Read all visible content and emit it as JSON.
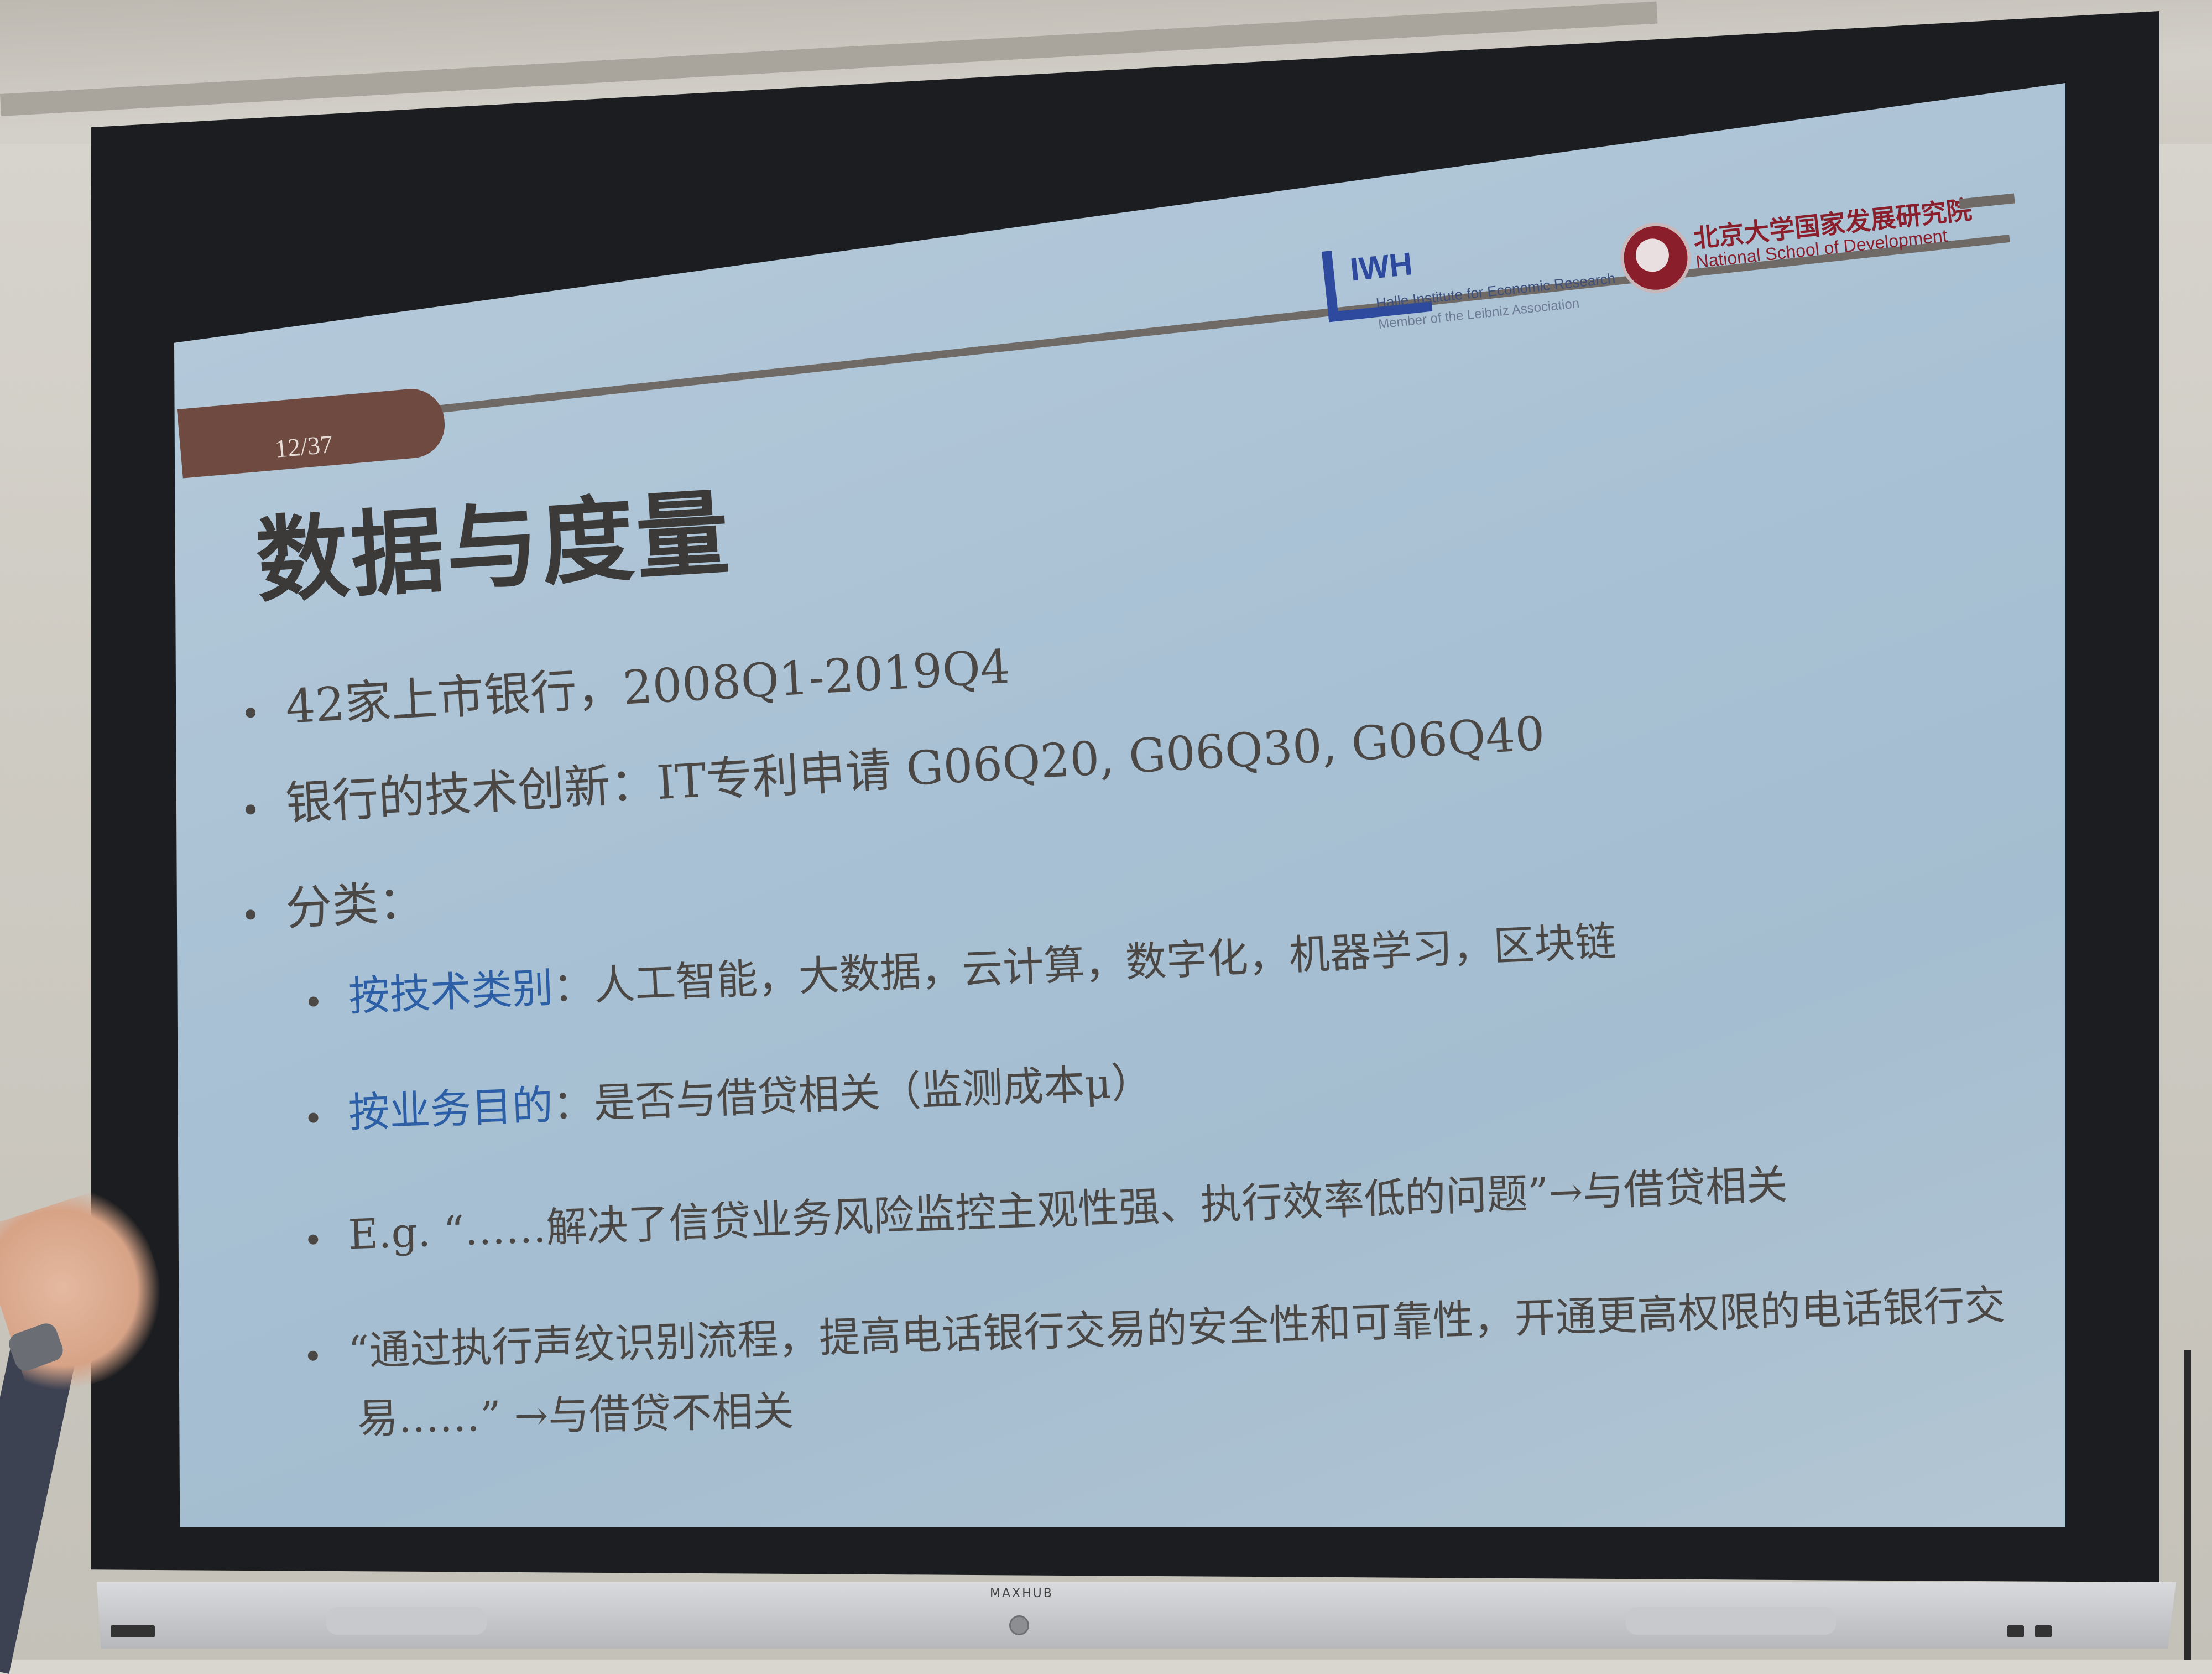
{
  "slide": {
    "page_number": "12/37",
    "title": "数据与度量",
    "logos": {
      "iwh": {
        "mark": "IWH",
        "name": "Halle Institute for Economic Research",
        "member": "Member of the Leibniz Association"
      },
      "pku": {
        "name_cn": "北京大学国家发展研究院",
        "name_en": "National School of Development"
      }
    },
    "bullets": [
      "42家上市银行，2008Q1-2019Q4",
      "银行的技术创新：IT专利申请  G06Q20, G06Q30, G06Q40",
      "分类："
    ],
    "sub_bullets": [
      {
        "label": "按技术类别",
        "text": "：人工智能，大数据，云计算，数字化，机器学习，区块链"
      },
      {
        "label": "按业务目的",
        "text": "：是否与借贷相关（监测成本μ）"
      },
      {
        "label": "",
        "text": "E.g. “……解决了信贷业务风险监控主观性强、执行效率低的问题”→与借贷相关"
      },
      {
        "label": "",
        "text": "“通过执行声纹识别流程，提高电话银行交易的安全性和可靠性，开通更高权限的电话银行交",
        "continuation": "易……”  →与借贷不相关"
      }
    ]
  },
  "monitor": {
    "brand": "MAXHUB"
  },
  "colors": {
    "screen_bg": "#aac1d4",
    "title_text": "#3b3a39",
    "highlight_blue": "#2c5fa6",
    "page_tab": "#6e4a40",
    "pku_red": "#8a1f2b",
    "iwh_blue": "#2e4a9e"
  }
}
